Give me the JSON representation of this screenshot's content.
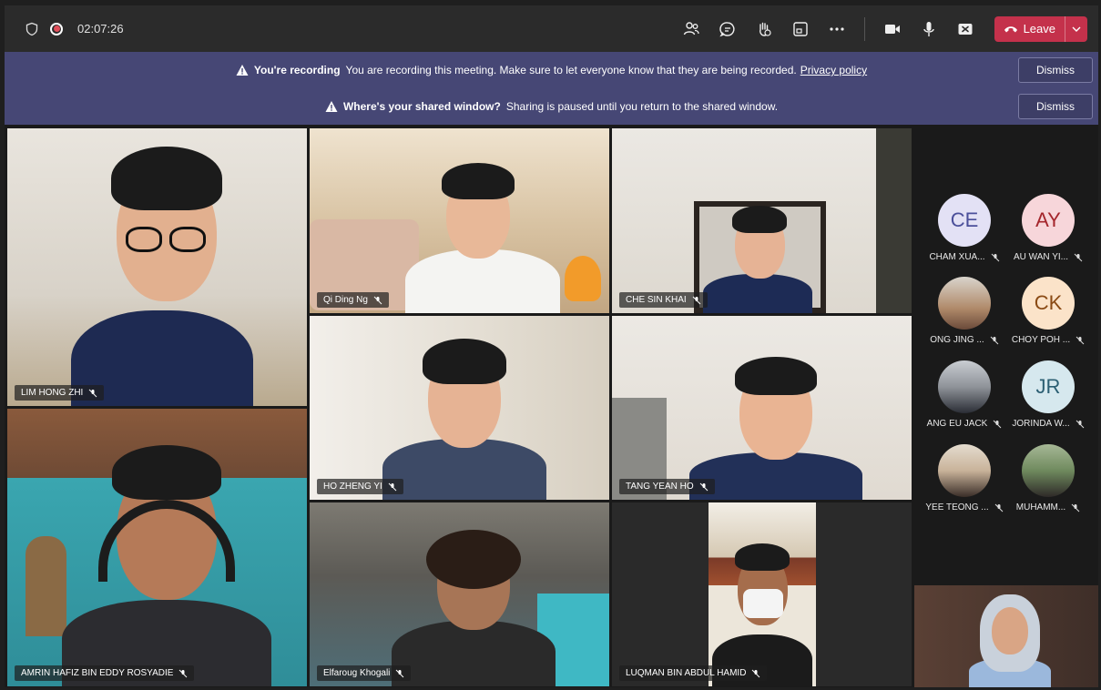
{
  "meeting": {
    "timer": "02:07:26",
    "leave_label": "Leave"
  },
  "banners": [
    {
      "title": "You're recording",
      "text": "You are recording this meeting. Make sure to let everyone know that they are being recorded.",
      "link": "Privacy policy",
      "dismiss": "Dismiss"
    },
    {
      "title": "Where's your shared window?",
      "text": "Sharing is paused until you return to the shared window.",
      "dismiss": "Dismiss"
    }
  ],
  "tiles": [
    {
      "name": "LIM HONG ZHI"
    },
    {
      "name": "Qi Ding Ng"
    },
    {
      "name": "CHE SIN KHAI"
    },
    {
      "name": "HO ZHENG YI"
    },
    {
      "name": "TANG YEAN HO"
    },
    {
      "name": "AMRIN HAFIZ BIN EDDY ROSYADIE"
    },
    {
      "name": "Elfaroug Khogali"
    },
    {
      "name": "LUQMAN BIN ABDUL HAMID"
    }
  ],
  "roster": [
    {
      "initials": "CE",
      "name": "CHAM XUA...",
      "bg": "#e3e1f5",
      "fg": "#4b4f9a"
    },
    {
      "initials": "AY",
      "name": "AU WAN YI...",
      "bg": "#f7d6da",
      "fg": "#a4262c"
    },
    {
      "initials": "",
      "name": "ONG JING ...",
      "bg": "#b5a897",
      "fg": "#ffffff"
    },
    {
      "initials": "CK",
      "name": "CHOY POH ...",
      "bg": "#fbe3c9",
      "fg": "#8a4a14"
    },
    {
      "initials": "",
      "name": "ANG EU JACK",
      "bg": "#8c8f94",
      "fg": "#ffffff"
    },
    {
      "initials": "JR",
      "name": "JORINDA W...",
      "bg": "#d6e8ee",
      "fg": "#2c5f73"
    },
    {
      "initials": "",
      "name": "YEE TEONG ...",
      "bg": "#c9b39a",
      "fg": "#ffffff"
    },
    {
      "initials": "",
      "name": "MUHAMM...",
      "bg": "#6f8a5e",
      "fg": "#ffffff"
    }
  ]
}
